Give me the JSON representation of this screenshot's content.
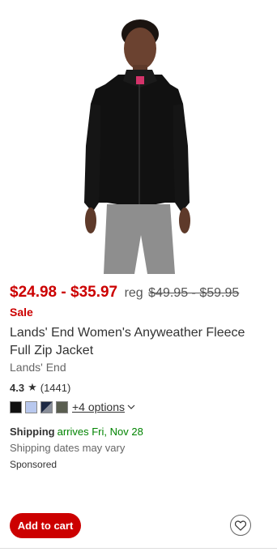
{
  "product": {
    "price_range": "$24.98 - $35.97",
    "reg_label": "reg",
    "reg_price": "$49.95 - $59.95",
    "sale_label": "Sale",
    "title": "Lands' End Women's Anyweather Fleece Full Zip Jacket",
    "brand": "Lands' End",
    "rating_value": "4.3",
    "rating_count": "(1441)",
    "swatch_colors": [
      "#111111",
      "#b8c8ee",
      "#1e2a44",
      "#5a5e50"
    ],
    "more_options": "+4 options"
  },
  "shipping": {
    "label": "Shipping",
    "arrives": "arrives Fri, Nov 28",
    "note": "Shipping dates may vary"
  },
  "sponsored": "Sponsored",
  "actions": {
    "add_to_cart": "Add to cart"
  },
  "icons": {
    "rating": "star-icon",
    "options": "chevron-down-icon",
    "favorite": "heart-icon"
  },
  "colors": {
    "accent_red": "#cc0000",
    "ship_green": "#008300"
  }
}
